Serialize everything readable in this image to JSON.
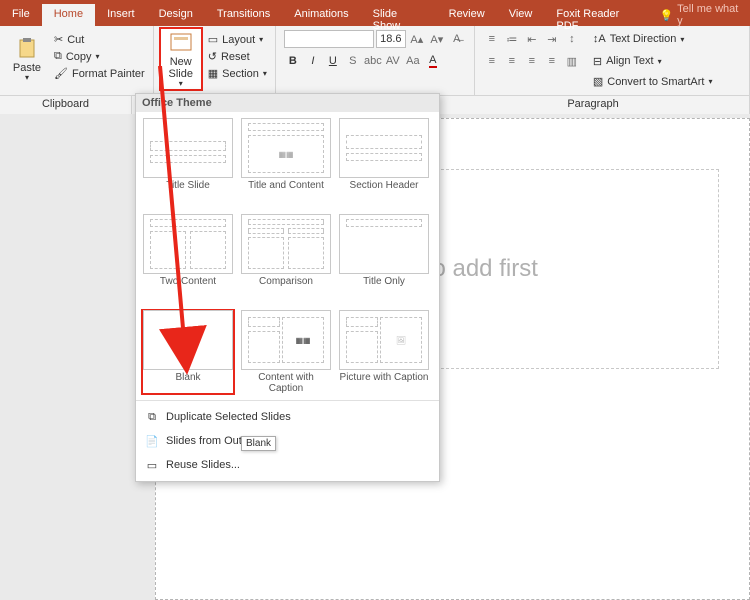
{
  "tabs": {
    "file": "File",
    "home": "Home",
    "insert": "Insert",
    "design": "Design",
    "transitions": "Transitions",
    "animations": "Animations",
    "slideshow": "Slide Show",
    "review": "Review",
    "view": "View",
    "foxit": "Foxit Reader PDF",
    "tellme": "Tell me what y"
  },
  "clipboard": {
    "paste": "Paste",
    "cut": "Cut",
    "copy": "Copy",
    "format_painter": "Format Painter",
    "group": "Clipboard"
  },
  "slides": {
    "new_slide": "New Slide",
    "layout": "Layout",
    "reset": "Reset",
    "section": "Section"
  },
  "font": {
    "size": "18.6"
  },
  "paragraph": {
    "text_direction": "Text Direction",
    "align_text": "Align Text",
    "convert_smartart": "Convert to SmartArt",
    "group": "Paragraph"
  },
  "gallery": {
    "header": "Office Theme",
    "items": [
      "Title Slide",
      "Title and Content",
      "Section Header",
      "Two Content",
      "Comparison",
      "Title Only",
      "Blank",
      "Content with Caption",
      "Picture with Caption"
    ],
    "dup": "Duplicate Selected Slides",
    "outline": "Slides from Outline...",
    "reuse": "Reuse Slides..."
  },
  "canvas": {
    "title_placeholder": "Click to add first"
  },
  "tooltip": "Blank"
}
